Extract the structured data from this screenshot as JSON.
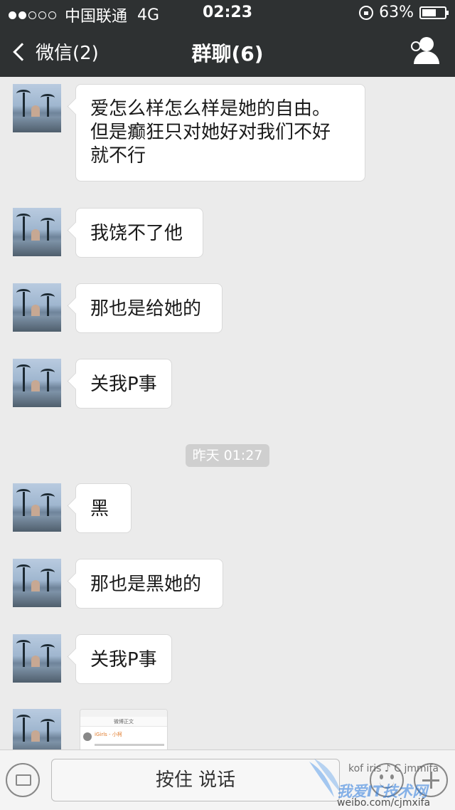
{
  "status_bar": {
    "carrier": "中国联通",
    "network": "4G",
    "time": "02:23",
    "battery": "63%",
    "battery_level": 0.63
  },
  "nav": {
    "back_label": "微信(2)",
    "title": "群聊(6)"
  },
  "messages": [
    {
      "text": "爱怎么样怎么样是她的自由。\n但是癫狂只对她好对我们不好\n就不行"
    },
    {
      "text": "我饶不了他"
    },
    {
      "text": "那也是给她的"
    },
    {
      "text": "关我P事"
    },
    {
      "text": "黑"
    },
    {
      "text": "那也是黑她的"
    },
    {
      "text": "关我P事"
    }
  ],
  "timestamp": "昨天 01:27",
  "image_message": {
    "header": "微博正文",
    "user": "iGirls - 小柯"
  },
  "toolbar": {
    "voice_label": "按住 说话"
  },
  "watermark": {
    "line1": "kof iris ♪ C jmmifa",
    "line2": "我爱IT技术网",
    "line3": "weibo.com/cjmxifa"
  }
}
